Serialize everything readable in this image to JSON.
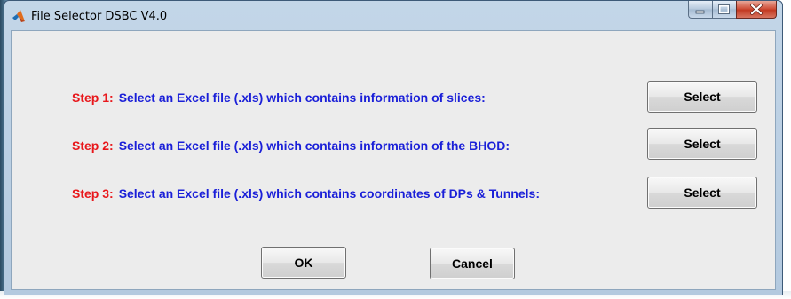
{
  "window": {
    "title": "File Selector DSBC V4.0",
    "app_icon": "matlab-icon"
  },
  "steps": [
    {
      "label": "Step 1:",
      "description": "Select an Excel file (.xls) which contains information of slices:",
      "button_label": "Select"
    },
    {
      "label": "Step 2:",
      "description": "Select an Excel file (.xls) which contains information of the BHOD:",
      "button_label": "Select"
    },
    {
      "label": "Step 3:",
      "description": "Select an Excel file (.xls) which contains coordinates of DPs & Tunnels:",
      "button_label": "Select"
    }
  ],
  "footer": {
    "ok_label": "OK",
    "cancel_label": "Cancel"
  },
  "colors": {
    "step_label": "#e8171b",
    "step_description": "#1a1fd8",
    "dialog_background": "#ececec"
  }
}
